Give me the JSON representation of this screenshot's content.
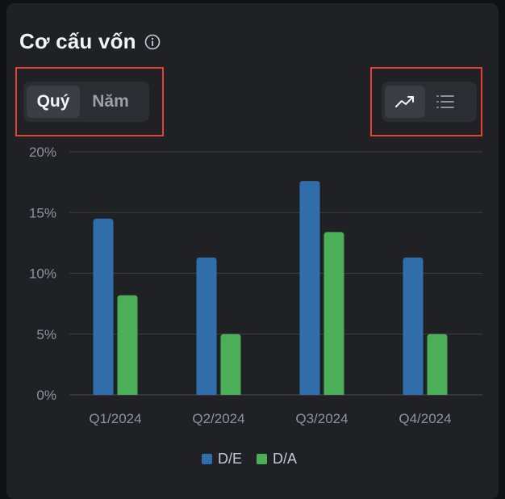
{
  "title": "Cơ cấu vốn",
  "icons": {
    "info": "info-icon",
    "line_chart": "trending-up-icon",
    "list": "list-icon"
  },
  "period_toggle": [
    {
      "label": "Quý",
      "active": true
    },
    {
      "label": "Năm",
      "active": false
    }
  ],
  "view_toggle": [
    {
      "icon": "trending-up-icon",
      "active": true
    },
    {
      "icon": "list-icon",
      "active": false
    }
  ],
  "colors": {
    "de": "#2f6ea9",
    "da": "#4caf57",
    "grid": "#3a3d42",
    "highlight": "#e0432f"
  },
  "chart_data": {
    "type": "bar",
    "categories": [
      "Q1/2024",
      "Q2/2024",
      "Q3/2024",
      "Q4/2024"
    ],
    "series": [
      {
        "name": "D/E",
        "values": [
          14.5,
          11.3,
          17.6,
          11.3
        ]
      },
      {
        "name": "D/A",
        "values": [
          8.2,
          5.0,
          13.4,
          5.0
        ]
      }
    ],
    "yticks": [
      "0%",
      "5%",
      "10%",
      "15%",
      "20%"
    ],
    "ylim": [
      0,
      20
    ],
    "grid": true,
    "legend_position": "bottom-center"
  }
}
